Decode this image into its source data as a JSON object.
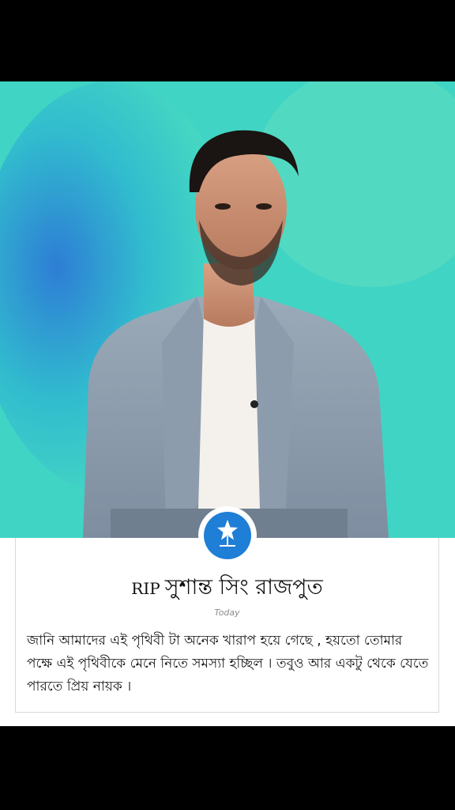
{
  "post": {
    "photo_alt": "portrait photo",
    "title_prefix": "RIP",
    "title": "সুশান্ত সিং রাজপুত",
    "date": "Today",
    "body": "জানি আমাদের এই পৃথিবী টা অনেক খারাপ হয়ে গেছে , হয়তো তোমার পক্ষে এই পৃথিবীকে মেনে নিতে সমস্যা হচ্ছিল । তবুও আর একটু থেকে যেতে পারতে প্রিয় নায়ক ।"
  },
  "colors": {
    "background": "#000000",
    "photo_bg": "#3fd8c6",
    "badge": "#1f7ed6",
    "card": "#ffffff"
  },
  "icons": {
    "badge_icon": "star-icon"
  }
}
